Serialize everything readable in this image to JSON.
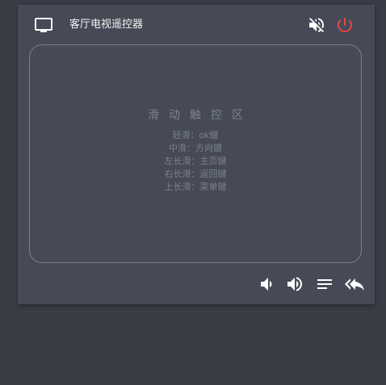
{
  "header": {
    "title": "客厅电视遥控器",
    "tv_icon": "tv-icon",
    "mute_icon": "volume-off-icon",
    "power_icon": "power-icon"
  },
  "touchpad": {
    "title": "滑动触控区",
    "hints": [
      "轻滑：ok键",
      "中滑：方向键",
      "左长滑：主页键",
      "右长滑：返回键",
      "上长滑：菜单键"
    ]
  },
  "controls": {
    "icons": [
      "volume-down-icon",
      "volume-up-icon",
      "menu-icon",
      "reply-all-icon"
    ]
  },
  "colors": {
    "background": "#383c45",
    "card": "#454a56",
    "power": "#e04848",
    "icon": "#ffffff",
    "muted_text": "#7c818c"
  }
}
